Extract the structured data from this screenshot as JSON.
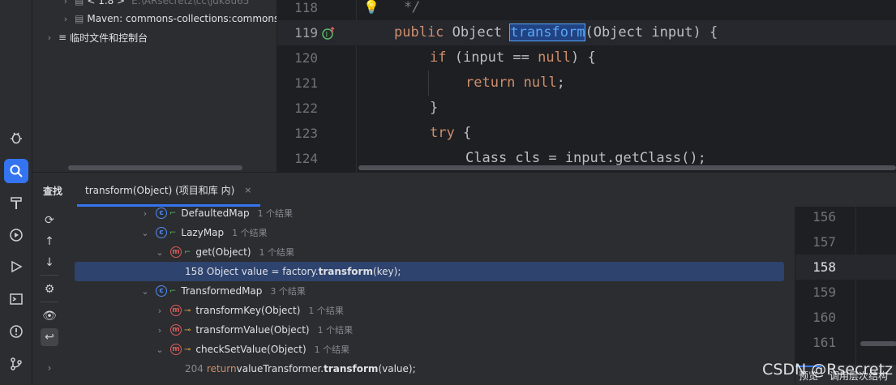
{
  "project_tree": {
    "rows": [
      {
        "label": "< 1.8 >",
        "extra": "E:\\ARsecretz\\cc\\jdk8u65"
      },
      {
        "label": "Maven: commons-collections:commons"
      },
      {
        "label": "临时文件和控制台"
      }
    ]
  },
  "editor": {
    "lines": [
      {
        "num": "118"
      },
      {
        "num": "119"
      },
      {
        "num": "120"
      },
      {
        "num": "121"
      },
      {
        "num": "122"
      },
      {
        "num": "123"
      },
      {
        "num": "124"
      }
    ],
    "code": {
      "l118": "*/",
      "l119_kw": "public",
      "l119_type": "Object",
      "l119_method": "transform",
      "l119_rest": "(Object input) {",
      "l120_kw": "if",
      "l120_a": " (input == ",
      "l120_null": "null",
      "l120_b": ") {",
      "l121_kw": "return",
      "l121_null": "null",
      "l121_end": ";",
      "l122": "}",
      "l123_kw": "try",
      "l123_rest": " {",
      "l124": "Class cls = input.getClass();"
    }
  },
  "find": {
    "title": "查找",
    "tab_label": "transform(Object) (项目和库 内)",
    "tab_close": "×",
    "results": [
      {
        "kind": "class",
        "label": "DefaultedMap",
        "count": "1 个结果"
      },
      {
        "kind": "class",
        "label": "LazyMap",
        "count": "1 个结果"
      },
      {
        "kind": "method",
        "label": "get(Object)",
        "count": "1 个结果"
      },
      {
        "kind": "usage",
        "line": "158",
        "pre": "Object value = factory.",
        "method": "transform",
        "post": "(key);"
      },
      {
        "kind": "class",
        "label": "TransformedMap",
        "count": "3 个结果"
      },
      {
        "kind": "method",
        "label": "transformKey(Object)",
        "count": "1 个结果"
      },
      {
        "kind": "method",
        "label": "transformValue(Object)",
        "count": "1 个结果"
      },
      {
        "kind": "method",
        "label": "checkSetValue(Object)",
        "count": "1 个结果"
      },
      {
        "kind": "usage",
        "line": "204",
        "kw": "return",
        "pre": " valueTransformer.",
        "method": "transform",
        "post": "(value);"
      }
    ]
  },
  "preview": {
    "lines": [
      "156",
      "157",
      "158",
      "159",
      "160",
      "161"
    ],
    "tabs": [
      "预览",
      "调用层次结构"
    ]
  },
  "watermark": "CSDN @Rsecretz",
  "colors": {
    "accent": "#3574f0",
    "selection": "#2e436e",
    "keyword": "#cf8e6d",
    "method": "#56a8f5"
  }
}
